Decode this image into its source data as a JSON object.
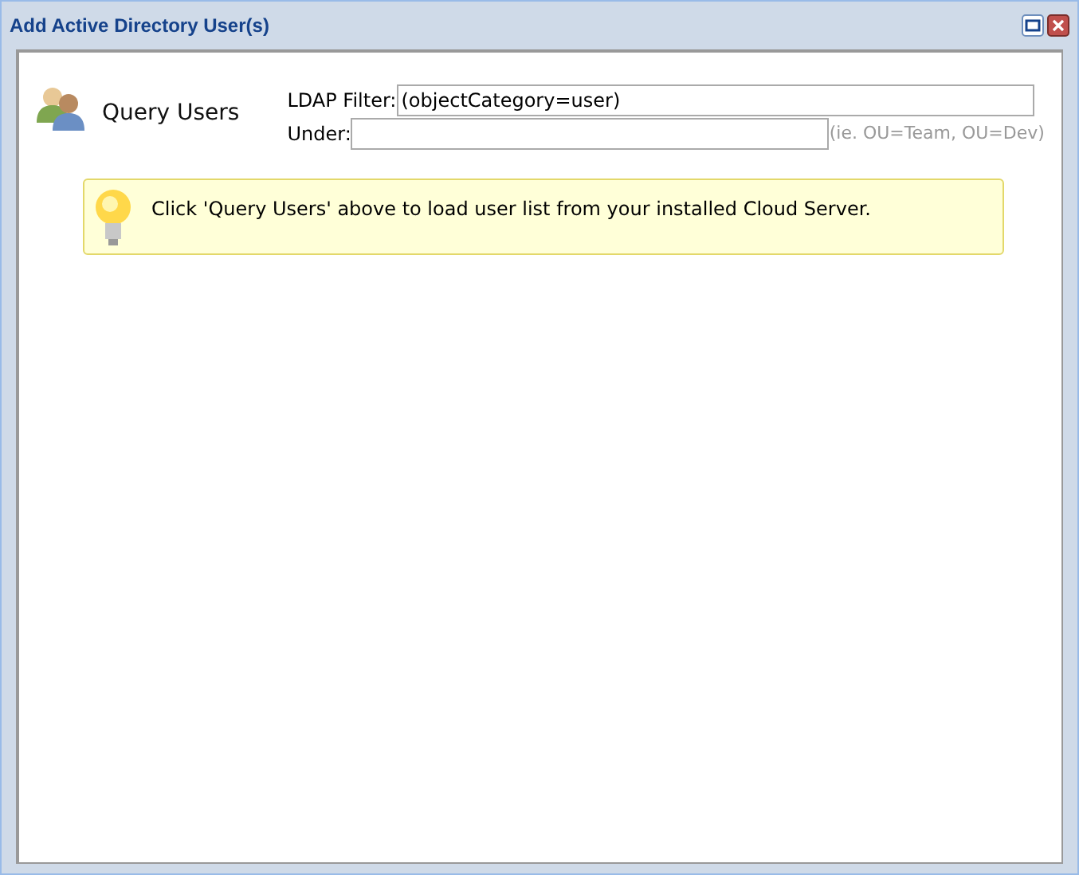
{
  "window": {
    "title": "Add Active Directory User(s)"
  },
  "query": {
    "label": "Query Users"
  },
  "ldap_filter": {
    "label": "LDAP Filter:",
    "value": "(objectCategory=user)"
  },
  "under": {
    "label": "Under:",
    "hint": "(ie. OU=Team, OU=Dev)"
  },
  "tip": {
    "text": "Click 'Query Users' above to load user list from your installed Cloud Server."
  }
}
